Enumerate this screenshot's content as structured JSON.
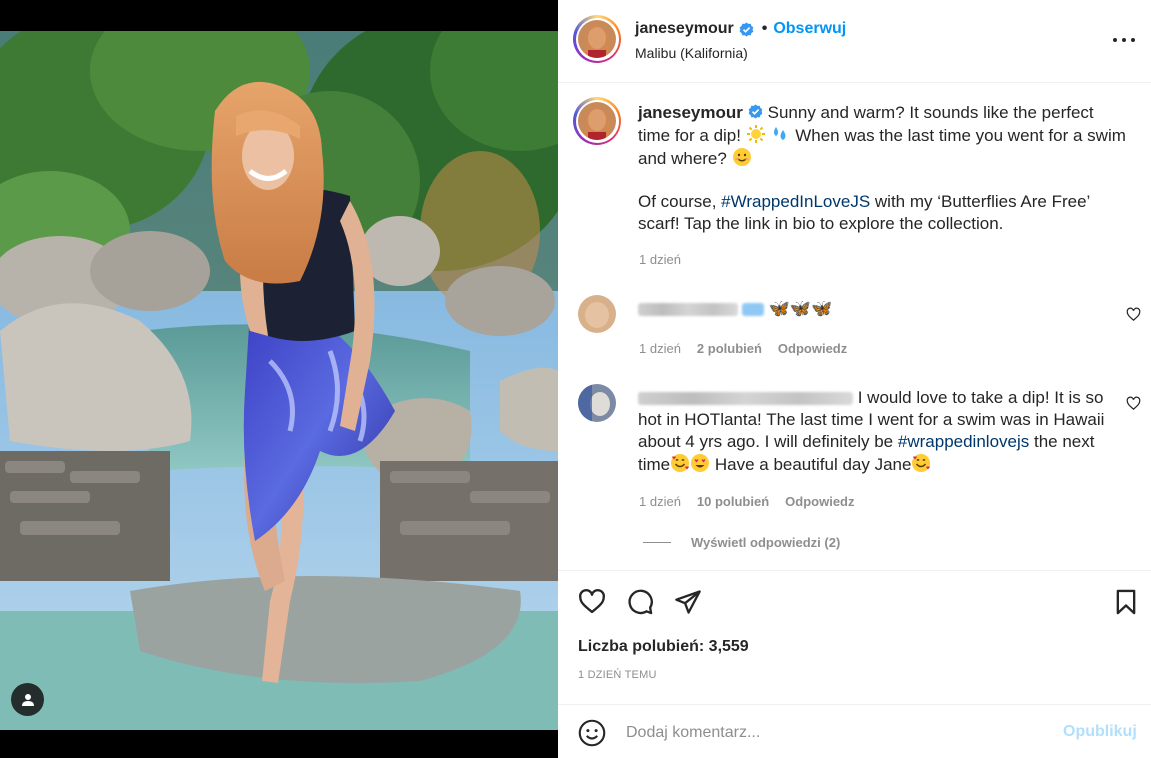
{
  "header": {
    "username": "janeseymour",
    "separator": "•",
    "follow_label": "Obserwuj",
    "location": "Malibu (Kalifornia)"
  },
  "caption": {
    "username": "janeseymour",
    "line1": "Sunny and warm? It sounds like the perfect time for a dip!",
    "line1b": "When was the last time you went for a swim and where?",
    "line2_pre": "Of course,",
    "hashtag": "#WrappedInLoveJS",
    "line2_post": "with my ‘Butterflies Are Free’ scarf! Tap the link in bio to explore the collection.",
    "time": "1 dzień"
  },
  "comments": [
    {
      "text": "🦋🦋🦋",
      "time": "1 dzień",
      "likes": "2 polubień",
      "reply": "Odpowiedz"
    },
    {
      "text_pre": "I would love to take a dip! It is so hot in HOTlanta! The last time I went for a swim was in Hawaii about 4 yrs ago. I will definitely be",
      "hashtag": "#wrappedinlovejs",
      "text_mid": "the next time",
      "text_post": "Have a beautiful day Jane",
      "time": "1 dzień",
      "likes": "10 polubień",
      "reply": "Odpowiedz"
    }
  ],
  "view_replies": "Wyświetl odpowiedzi (2)",
  "likes_label": "Liczba polubień: 3,559",
  "post_time": "1 DZIEŃ TEMU",
  "add_comment": {
    "placeholder": "Dodaj komentarz...",
    "publish_label": "Opublikuj"
  },
  "colors": {
    "link": "#0095f6",
    "hashtag": "#00376b",
    "muted": "#8e8e8e",
    "publish_disabled": "#b2dffc"
  },
  "icons": [
    "verified-badge-icon",
    "more-options-icon",
    "heart-icon",
    "comment-icon",
    "share-icon",
    "bookmark-icon",
    "smiley-icon",
    "user-tag-icon"
  ]
}
